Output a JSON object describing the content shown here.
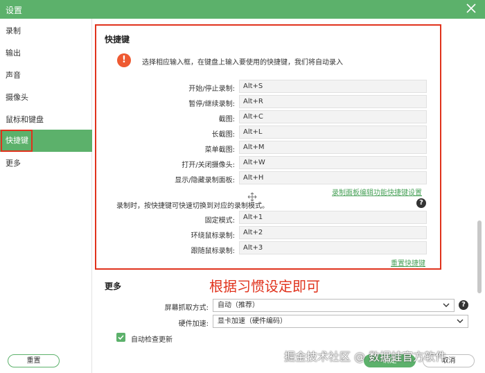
{
  "window": {
    "title": "设置"
  },
  "sidebar": {
    "items": [
      {
        "label": "录制"
      },
      {
        "label": "输出"
      },
      {
        "label": "声音"
      },
      {
        "label": "摄像头"
      },
      {
        "label": "鼠标和键盘"
      },
      {
        "label": "快捷键"
      },
      {
        "label": "更多"
      }
    ],
    "active_index": 5
  },
  "shortcuts": {
    "title": "快捷键",
    "hint": "选择相应输入框，在键盘上输入要使用的快捷键，我们将自动录入",
    "rows": [
      {
        "label": "开始/停止录制:",
        "value": "Alt+S"
      },
      {
        "label": "暂停/继续录制:",
        "value": "Alt+R"
      },
      {
        "label": "截图:",
        "value": "Alt+C"
      },
      {
        "label": "长截图:",
        "value": "Alt+L"
      },
      {
        "label": "菜单截图:",
        "value": "Alt+M"
      },
      {
        "label": "打开/关闭摄像头:",
        "value": "Alt+W"
      },
      {
        "label": "显示/隐藏录制面板:",
        "value": "Alt+H"
      }
    ],
    "panel_link": "录制面板编辑功能快捷键设置",
    "mode_hint": "录制时，按快捷键可快速切换到对应的录制模式。",
    "mode_rows": [
      {
        "label": "固定模式:",
        "value": "Alt+1"
      },
      {
        "label": "环绕鼠标录制:",
        "value": "Alt+2"
      },
      {
        "label": "跟随鼠标录制:",
        "value": "Alt+3"
      }
    ],
    "reset_link": "重置快捷键"
  },
  "annotation": {
    "text": "根据习惯设定即可"
  },
  "more": {
    "title": "更多",
    "capture_label": "屏幕抓取方式:",
    "capture_value": "自动（推荐）",
    "hw_label": "硬件加速:",
    "hw_value": "显卡加速（硬件编码）",
    "auto_update_label": "自动检查更新",
    "auto_update_checked": true
  },
  "footer": {
    "reset": "重置",
    "ok": "确定",
    "cancel": "取消"
  },
  "watermark": "掘金技术社区 @ 数据蛙官方软件",
  "colors": {
    "accent": "#5cb16b",
    "highlight": "#e0321c",
    "warning": "#ee5a32"
  }
}
